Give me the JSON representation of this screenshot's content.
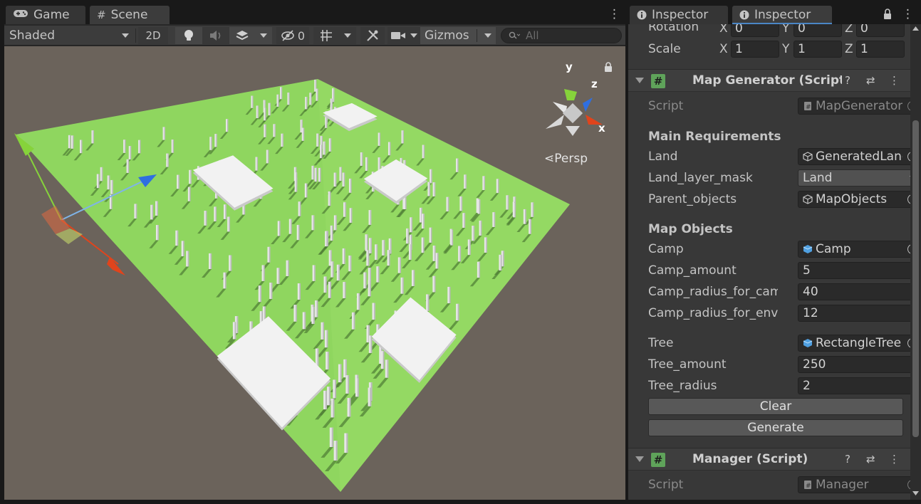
{
  "scene_panel": {
    "tabs": [
      {
        "label": "Game",
        "icon": "gamepad-icon"
      },
      {
        "label": "Scene",
        "icon": "hash-icon"
      }
    ],
    "toolbar": {
      "shading_mode": "Shaded",
      "mode_2d": "2D",
      "hidden_count": "0",
      "gizmos_label": "Gizmos",
      "search_placeholder": "All"
    },
    "viewport": {
      "projection_label": "Persp",
      "axis_labels": {
        "y": "y",
        "z": "z",
        "x": "x"
      },
      "colors": {
        "background": "#6b635b",
        "ground": "#8fd65f",
        "tree": "#e6e6e6",
        "camp": "#f2f2f2",
        "axis_x": "#e0441c",
        "axis_y": "#86d33b",
        "axis_z": "#2f6fe0"
      }
    }
  },
  "inspector": {
    "tabs": [
      {
        "label": "Inspector",
        "icon": "info-icon"
      },
      {
        "label": "Inspector",
        "icon": "info-icon"
      }
    ],
    "transform": {
      "rotation": {
        "label": "Rotation",
        "x": "0",
        "y": "0",
        "z": "0"
      },
      "scale": {
        "label": "Scale",
        "x": "1",
        "y": "1",
        "z": "1"
      }
    },
    "map_generator": {
      "title": "Map Generator (Script)",
      "script_label": "Script",
      "script_value": "MapGenerator",
      "main_requirements_title": "Main Requirements",
      "land_label": "Land",
      "land_value": "GeneratedLand",
      "land_layer_mask_label": "Land_layer_mask",
      "land_layer_mask_value": "Land",
      "parent_objects_label": "Parent_objects",
      "parent_objects_value": "MapObjects",
      "map_objects_title": "Map Objects",
      "camp_label": "Camp",
      "camp_value": "Camp",
      "camp_amount_label": "Camp_amount",
      "camp_amount_value": "5",
      "camp_radius_camp_label": "Camp_radius_for_camp",
      "camp_radius_camp_value": "40",
      "camp_radius_env_label": "Camp_radius_for_environment",
      "camp_radius_env_value": "12",
      "tree_label": "Tree",
      "tree_value": "RectangleTree",
      "tree_amount_label": "Tree_amount",
      "tree_amount_value": "250",
      "tree_radius_label": "Tree_radius",
      "tree_radius_value": "2",
      "clear_button": "Clear",
      "generate_button": "Generate"
    },
    "manager": {
      "title": "Manager (Script)",
      "script_label": "Script",
      "script_value": "Manager"
    }
  }
}
